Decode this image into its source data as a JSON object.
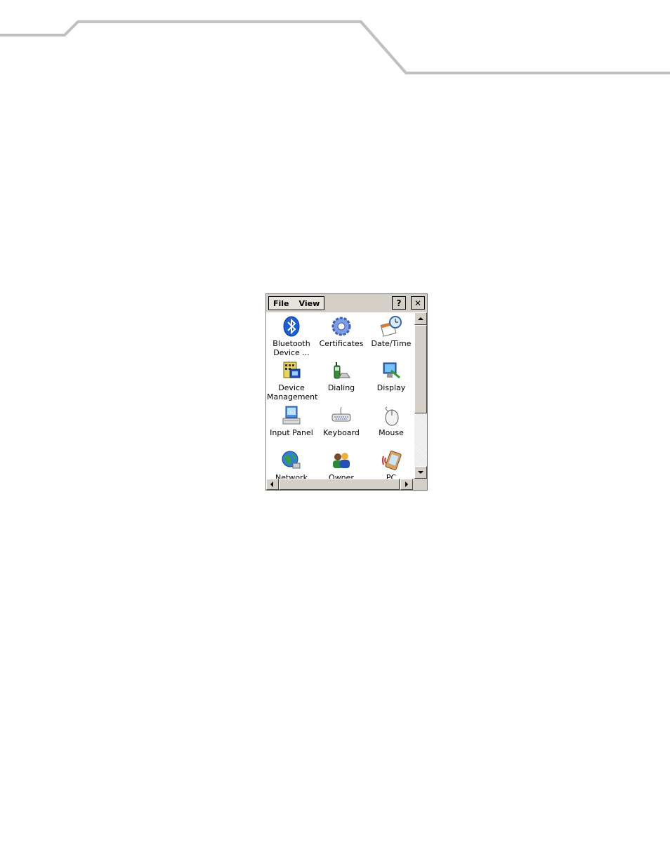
{
  "menu": {
    "file_label": "File",
    "view_label": "View",
    "help_label": "?",
    "close_label": "✕"
  },
  "items": [
    {
      "label": "Bluetooth\nDevice ...",
      "icon": "bluetooth-icon"
    },
    {
      "label": "Certificates",
      "icon": "certificates-icon"
    },
    {
      "label": "Date/Time",
      "icon": "date-time-icon"
    },
    {
      "label": "Device\nManagement",
      "icon": "device-management-icon"
    },
    {
      "label": "Dialing",
      "icon": "dialing-icon"
    },
    {
      "label": "Display",
      "icon": "display-icon"
    },
    {
      "label": "Input Panel",
      "icon": "input-panel-icon"
    },
    {
      "label": "Keyboard",
      "icon": "keyboard-icon"
    },
    {
      "label": "Mouse",
      "icon": "mouse-icon"
    },
    {
      "label": "Network and",
      "icon": "network-icon"
    },
    {
      "label": "Owner",
      "icon": "owner-icon"
    },
    {
      "label": "PC",
      "icon": "pc-connection-icon"
    }
  ],
  "colors": {
    "chrome": "#d4d0c8",
    "header_line": "#c0c0c0"
  }
}
